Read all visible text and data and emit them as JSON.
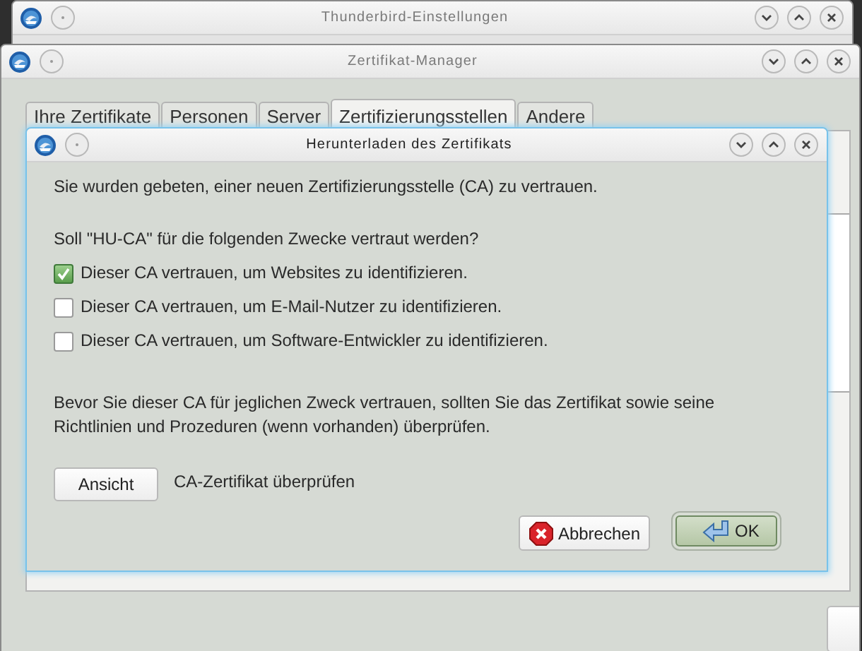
{
  "background_window": {
    "title": "Thunderbird-Einstellungen"
  },
  "manager_window": {
    "title": "Zertifikat-Manager",
    "tabs": [
      {
        "label": "Ihre Zertifikate",
        "selected": false
      },
      {
        "label": "Personen",
        "selected": false
      },
      {
        "label": "Server",
        "selected": false
      },
      {
        "label": "Zertifizierungsstellen",
        "selected": true
      },
      {
        "label": "Andere",
        "selected": false
      }
    ]
  },
  "dialog": {
    "title": "Herunterladen des Zertifikats",
    "intro": "Sie wurden gebeten, einer neuen Zertifizierungsstelle (CA) zu vertrauen.",
    "question": "Soll \"HU-CA\" für die folgenden Zwecke vertraut werden?",
    "options": [
      {
        "label": "Dieser CA vertrauen, um Websites zu identifizieren.",
        "checked": true
      },
      {
        "label": "Dieser CA vertrauen, um E-Mail-Nutzer zu identifizieren.",
        "checked": false
      },
      {
        "label": "Dieser CA vertrauen, um Software-Entwickler zu identifizieren.",
        "checked": false
      }
    ],
    "note": "Bevor Sie dieser CA für jeglichen Zweck vertrauen, sollten Sie das Zertifikat sowie seine Richtlinien und Prozeduren (wenn vorhanden) überprüfen.",
    "view_button": "Ansicht",
    "view_label": "CA-Zertifikat überprüfen",
    "buttons": [
      {
        "label": "Abbrechen",
        "kind": "cancel"
      },
      {
        "label": "OK",
        "kind": "ok"
      }
    ]
  }
}
